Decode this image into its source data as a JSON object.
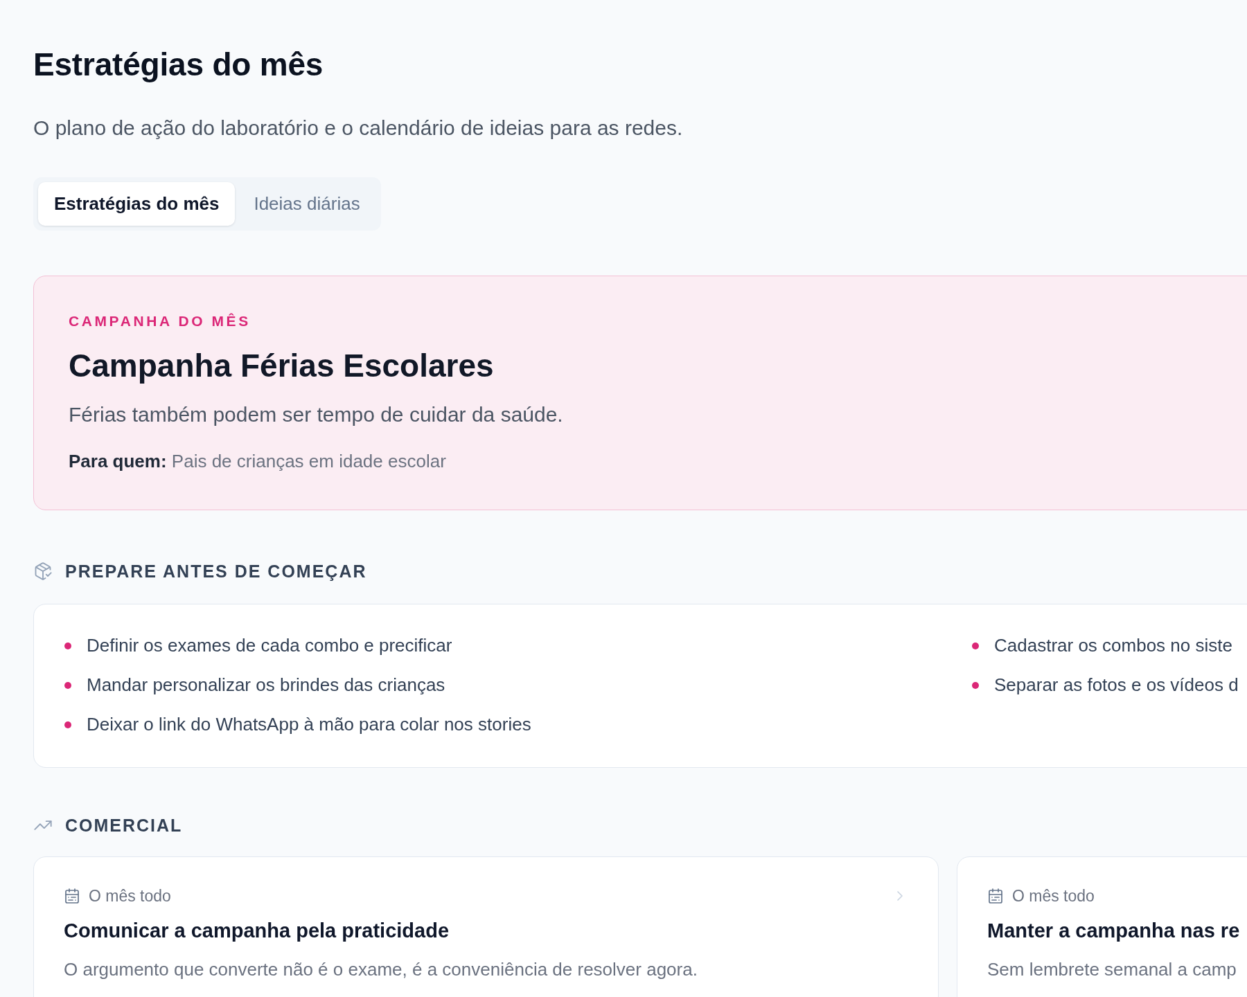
{
  "page": {
    "title": "Estratégias do mês",
    "subtitle": "O plano de ação do laboratório e o calendário de ideias para as redes."
  },
  "tabs": [
    {
      "label": "Estratégias do mês",
      "selected": true
    },
    {
      "label": "Ideias diárias",
      "selected": false
    }
  ],
  "campaign": {
    "eyebrow": "CAMPANHA DO MÊS",
    "title": "Campanha Férias Escolares",
    "tagline": "Férias também podem ser tempo de cuidar da saúde.",
    "audience": "**Para quem:** Pais de crianças em idade escolar"
  },
  "prepare": {
    "heading": "PREPARE ANTES DE COMEÇAR",
    "items": [
      "Definir os exames de cada combo e precificar",
      "Cadastrar os combos no siste",
      "Mandar personalizar os brindes das crianças",
      "Separar as fotos e os vídeos d",
      "Deixar o link do WhatsApp à mão para colar nos stories"
    ]
  },
  "commercial": {
    "heading": "COMERCIAL",
    "cards": [
      {
        "when": "O mês todo",
        "title": "Comunicar a campanha pela praticidade",
        "description": "O argumento que converte não é o exame, é a conveniência de resolver agora."
      },
      {
        "when": "O mês todo",
        "title": "Manter a campanha nas re",
        "description": "Sem lembrete semanal a camp"
      }
    ]
  }
}
